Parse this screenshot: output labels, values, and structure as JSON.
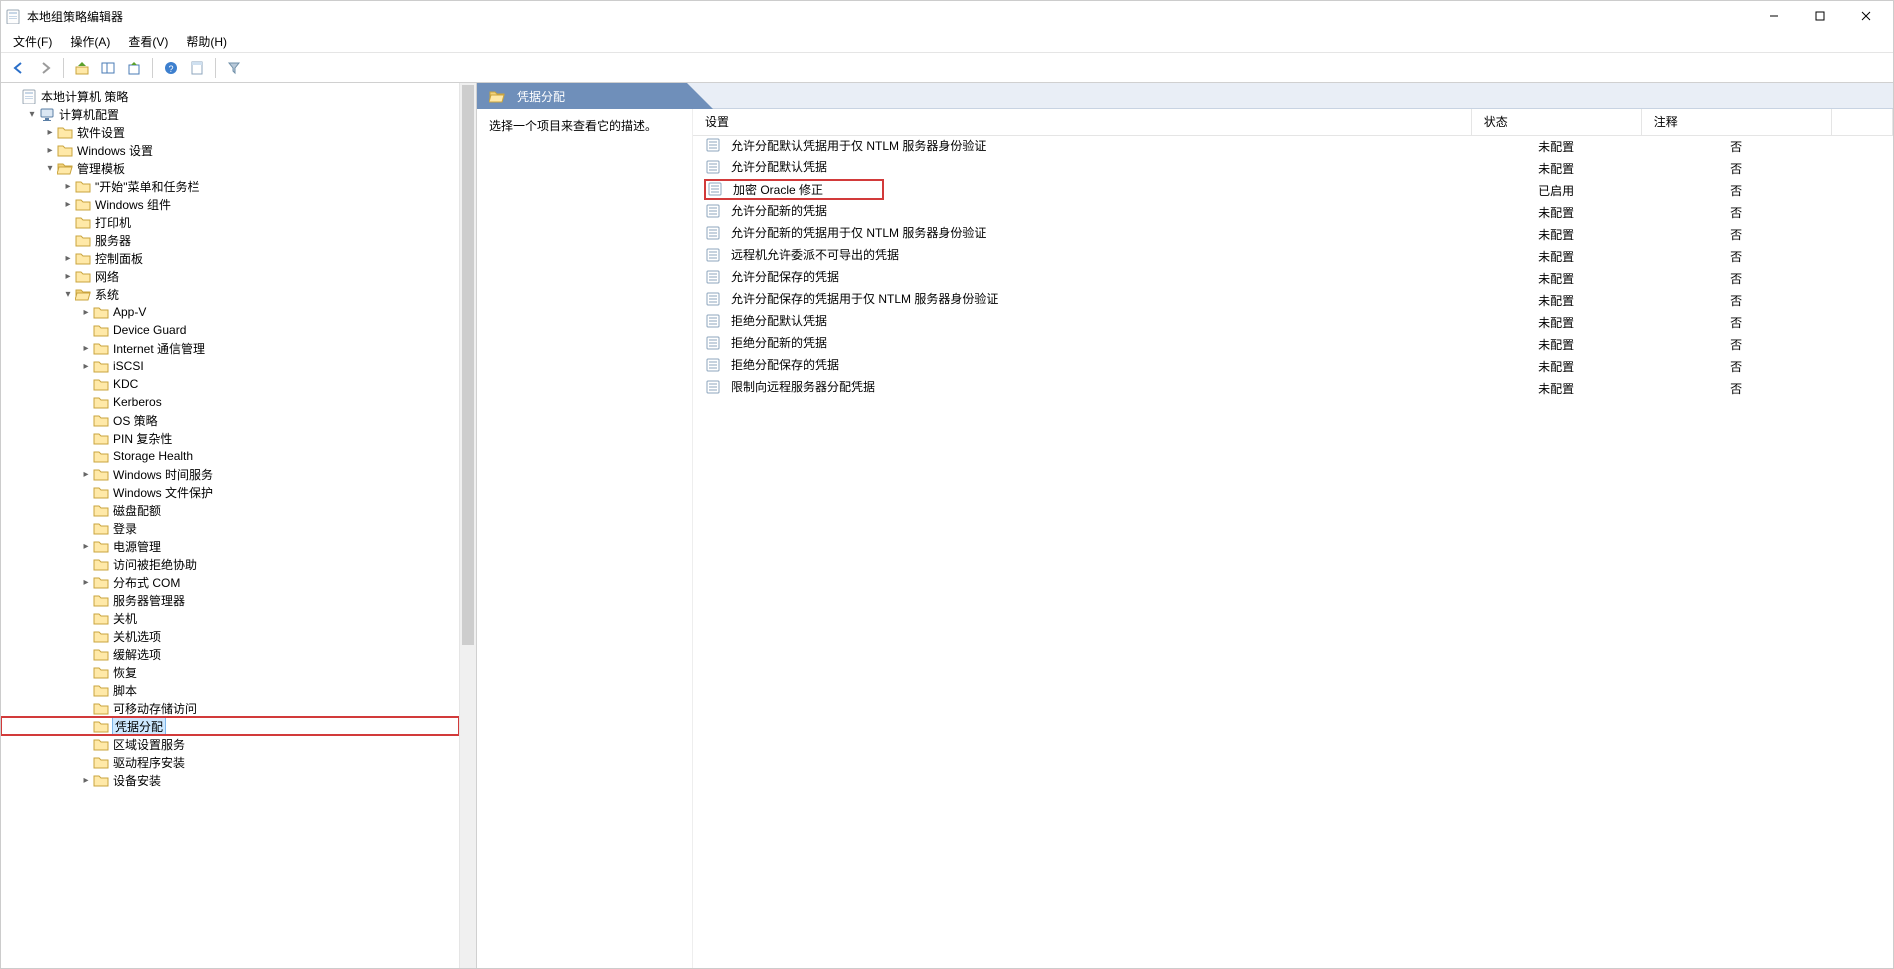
{
  "title": "本地组策略编辑器",
  "menu": {
    "file": "文件(F)",
    "action": "操作(A)",
    "view": "查看(V)",
    "help": "帮助(H)"
  },
  "tree": {
    "root": "本地计算机 策略",
    "computer_config": "计算机配置",
    "software_settings": "软件设置",
    "windows_settings": "Windows 设置",
    "admin_templates": "管理模板",
    "start_menu": "\"开始\"菜单和任务栏",
    "windows_components": "Windows 组件",
    "printers": "打印机",
    "servers": "服务器",
    "control_panel": "控制面板",
    "network": "网络",
    "system": "系统",
    "appv": "App-V",
    "device_guard": "Device Guard",
    "internet_comm": "Internet 通信管理",
    "iscsi": "iSCSI",
    "kdc": "KDC",
    "kerberos": "Kerberos",
    "os_policies": "OS 策略",
    "pin_complexity": "PIN 复杂性",
    "storage_health": "Storage Health",
    "windows_time": "Windows 时间服务",
    "windows_file_protection": "Windows 文件保护",
    "disk_quotas": "磁盘配额",
    "logon": "登录",
    "power_mgmt": "电源管理",
    "access_denied": "访问被拒绝协助",
    "dcom": "分布式 COM",
    "server_manager": "服务器管理器",
    "shutdown": "关机",
    "shutdown_options": "关机选项",
    "mitigation_options": "缓解选项",
    "recovery": "恢复",
    "scripts": "脚本",
    "removable_storage": "可移动存储访问",
    "credential_delegation": "凭据分配",
    "locale_services": "区域设置服务",
    "driver_installation": "驱动程序安装",
    "device_installation": "设备安装"
  },
  "right": {
    "header_title": "凭据分配",
    "description_prompt": "选择一个项目来查看它的描述。",
    "columns": {
      "setting": "设置",
      "status": "状态",
      "comment": "注释"
    }
  },
  "policies": [
    {
      "name": "允许分配默认凭据用于仅 NTLM 服务器身份验证",
      "status": "未配置",
      "comment": "否",
      "highlight": false
    },
    {
      "name": "允许分配默认凭据",
      "status": "未配置",
      "comment": "否",
      "highlight": false
    },
    {
      "name": "加密 Oracle 修正",
      "status": "已启用",
      "comment": "否",
      "highlight": true
    },
    {
      "name": "允许分配新的凭据",
      "status": "未配置",
      "comment": "否",
      "highlight": false
    },
    {
      "name": "允许分配新的凭据用于仅 NTLM 服务器身份验证",
      "status": "未配置",
      "comment": "否",
      "highlight": false
    },
    {
      "name": "远程机允许委派不可导出的凭据",
      "status": "未配置",
      "comment": "否",
      "highlight": false
    },
    {
      "name": "允许分配保存的凭据",
      "status": "未配置",
      "comment": "否",
      "highlight": false
    },
    {
      "name": "允许分配保存的凭据用于仅 NTLM 服务器身份验证",
      "status": "未配置",
      "comment": "否",
      "highlight": false
    },
    {
      "name": "拒绝分配默认凭据",
      "status": "未配置",
      "comment": "否",
      "highlight": false
    },
    {
      "name": "拒绝分配新的凭据",
      "status": "未配置",
      "comment": "否",
      "highlight": false
    },
    {
      "name": "拒绝分配保存的凭据",
      "status": "未配置",
      "comment": "否",
      "highlight": false
    },
    {
      "name": "限制向远程服务器分配凭据",
      "status": "未配置",
      "comment": "否",
      "highlight": false
    }
  ]
}
